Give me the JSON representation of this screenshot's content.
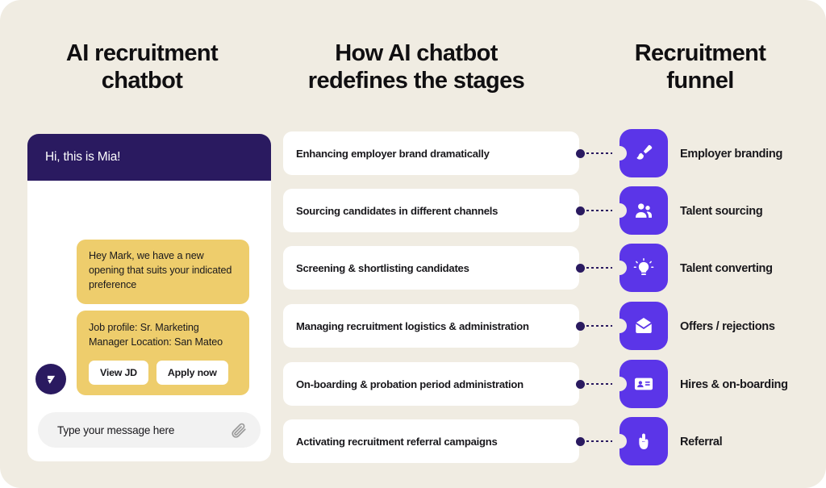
{
  "columns": {
    "left_title": "AI recruitment chatbot",
    "middle_title": "How AI chatbot redefines the stages",
    "right_title": "Recruitment funnel"
  },
  "chat": {
    "header_title": "Hi, this is Mia!",
    "avatar_icon": "brand-logo-icon",
    "messages": [
      {
        "text": "Hey Mark, we have a new opening that suits your indicated preference",
        "buttons": []
      },
      {
        "text": "Job profile: Sr. Marketing Manager Location: San Mateo",
        "buttons": [
          "View JD",
          "Apply now"
        ]
      }
    ],
    "composer": {
      "value": "",
      "placeholder": "Type your message here",
      "attach_icon": "paperclip-icon"
    }
  },
  "stages": [
    "Enhancing employer brand dramatically",
    "Sourcing candidates in different channels",
    "Screening & shortlisting candidates",
    "Managing recruitment logistics & administration",
    "On-boarding & probation period administration",
    "Activating recruitment referral campaigns"
  ],
  "funnel": [
    {
      "label": "Employer branding",
      "icon": "paintbrush-icon"
    },
    {
      "label": "Talent sourcing",
      "icon": "user-group-icon"
    },
    {
      "label": "Talent converting",
      "icon": "lightbulb-icon"
    },
    {
      "label": "Offers / rejections",
      "icon": "envelope-icon"
    },
    {
      "label": "Hires & on-boarding",
      "icon": "id-card-icon"
    },
    {
      "label": "Referral",
      "icon": "hand-pointer-icon"
    }
  ],
  "colors": {
    "background": "#f0ece2",
    "card": "#ffffff",
    "navy": "#2a1a60",
    "indigo": "#5b35e8",
    "yellow": "#eecd6c",
    "text": "#19181c"
  }
}
